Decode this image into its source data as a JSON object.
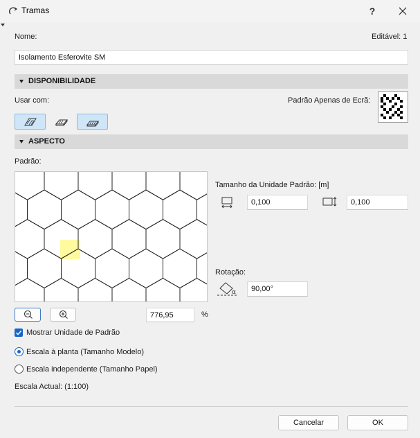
{
  "window": {
    "title": "Tramas",
    "help_label": "?"
  },
  "name_label": "Nome:",
  "editable_label": "Editável: 1",
  "name_value": "Isolamento Esferovite SM",
  "availability": {
    "header": "DISPONIBILIDADE",
    "use_with_label": "Usar com:",
    "screen_pattern_label": "Padrão Apenas de Ecrã:"
  },
  "aspect": {
    "header": "ASPECTO",
    "pattern_label": "Padrão:",
    "unit_size_label": "Tamanho da Unidade Padrão: [m]",
    "width_value": "0,100",
    "height_value": "0,100",
    "rotation_label": "Rotação:",
    "rotation_value": "90,00°",
    "zoom_value": "776,95",
    "zoom_unit": "%",
    "show_unit_label": "Mostrar Unidade de Padrão",
    "scale_model_label": "Escala à planta (Tamanho Modelo)",
    "scale_paper_label": "Escala independente (Tamanho Papel)",
    "current_scale_label": "Escala Actual: (1:100)"
  },
  "buttons": {
    "cancel": "Cancelar",
    "ok": "OK"
  },
  "colors": {
    "accent": "#1766c7",
    "unit_highlight": "#fffaa0",
    "section_bg": "#d9d9d9"
  }
}
